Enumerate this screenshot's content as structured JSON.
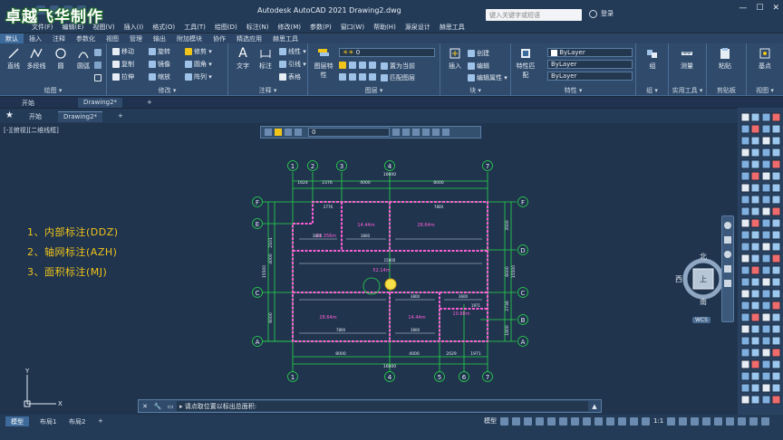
{
  "watermark": "卓越飞华制作",
  "app": {
    "title": "Autodesk AutoCAD 2021    Drawing2.dwg",
    "search_placeholder": "键入关键字或短语",
    "login": "登录",
    "controls": [
      "—",
      "☐",
      "✕"
    ]
  },
  "menu": [
    "文件(F)",
    "编辑(E)",
    "视图(V)",
    "插入(I)",
    "格式(O)",
    "工具(T)",
    "绘图(D)",
    "标注(N)",
    "修改(M)",
    "参数(P)",
    "窗口(W)",
    "帮助(H)",
    "源泉设计",
    "赫思工具"
  ],
  "ribbon_tabs": [
    "默认",
    "插入",
    "注释",
    "参数化",
    "视图",
    "管理",
    "输出",
    "附加模块",
    "协作",
    "精选应用",
    "赫思工具"
  ],
  "ribbon": {
    "draw": {
      "title": "绘图 ▾",
      "line": "直线",
      "polyline": "多段线",
      "circle": "圆",
      "arc": "圆弧"
    },
    "modify": {
      "title": "修改 ▾",
      "move": "移动",
      "rotate": "旋转",
      "trim": "修剪 ▾",
      "copy": "复制",
      "mirror": "镜像",
      "fillet": "圆角 ▾",
      "stretch": "拉伸",
      "scale": "缩放",
      "array": "阵列 ▾"
    },
    "annotation": {
      "title": "注释 ▾",
      "text": "文字",
      "dimension": "标注",
      "linear": "线性 ▾",
      "leader": "引线 ▾",
      "table": "表格"
    },
    "layers": {
      "title": "图层 ▾",
      "props": "图层特性",
      "current_layer": "0",
      "make_current": "置为当前",
      "match": "匹配图层"
    },
    "block": {
      "title": "块 ▾",
      "insert": "插入",
      "create": "创建",
      "edit": "编辑",
      "edit_attr": "编辑属性 ▾"
    },
    "properties": {
      "title": "特性 ▾",
      "match": "特性匹配",
      "color": "ByLayer",
      "linetype": "ByLayer",
      "lineweight": "ByLayer"
    },
    "groups": {
      "title": "组 ▾",
      "group": "组"
    },
    "utilities": {
      "title": "实用工具 ▾",
      "measure": "测量"
    },
    "clipboard": {
      "title": "剪贴板",
      "paste": "粘贴"
    },
    "view": {
      "title": "视图 ▾",
      "base": "基点"
    }
  },
  "file_tabs": [
    "开始",
    "Drawing2*",
    "+"
  ],
  "doc_tabs": [
    "开始",
    "Drawing2*",
    "+"
  ],
  "viewport_label": "[-][俯视][二维线框]",
  "floatbar_layer": "0",
  "annotations": [
    "1、内部标注(DDZ)",
    "2、轴网标注(AZH)",
    "3、面积标注(MJ)"
  ],
  "navcube": {
    "north": "北",
    "south": "南",
    "east": "东",
    "west": "西",
    "top": "上",
    "wcs": "WCS"
  },
  "drawing": {
    "axes_top": [
      "1",
      "2",
      "3",
      "4",
      "7"
    ],
    "axes_bottom": [
      "1",
      "4",
      "5",
      "6",
      "7"
    ],
    "axes_left": [
      "F",
      "E",
      "C",
      "A"
    ],
    "axes_right": [
      "F",
      "D",
      "C",
      "B",
      "A"
    ],
    "top_dims": [
      "1624",
      "2376",
      "4000",
      "8000"
    ],
    "top_total": "16000",
    "bottom_dims": [
      "8000",
      "4000",
      "2029",
      "1971"
    ],
    "bottom_total": "16000",
    "left_dims": [
      "2101",
      "4000",
      "6000"
    ],
    "left_total": "15500",
    "right_dims": [
      "3500",
      "6000",
      "2736",
      "1800"
    ],
    "right_total": "15500",
    "room_areas": [
      "11.356m",
      "14.44m",
      "28.64m",
      "52.14m",
      "28.64m",
      "14.44m",
      "10.88m"
    ],
    "inner_dims": [
      "2776",
      "3800",
      "7800",
      "3800",
      "15800",
      "3800",
      "7800",
      "3800",
      "1971",
      "3600"
    ]
  },
  "command": {
    "prompt": "▸ 请点取位置以标出总面积:"
  },
  "layouts": [
    "模型",
    "布局1",
    "布局2",
    "+"
  ],
  "status": {
    "model": "模型",
    "scale": "1:1"
  }
}
